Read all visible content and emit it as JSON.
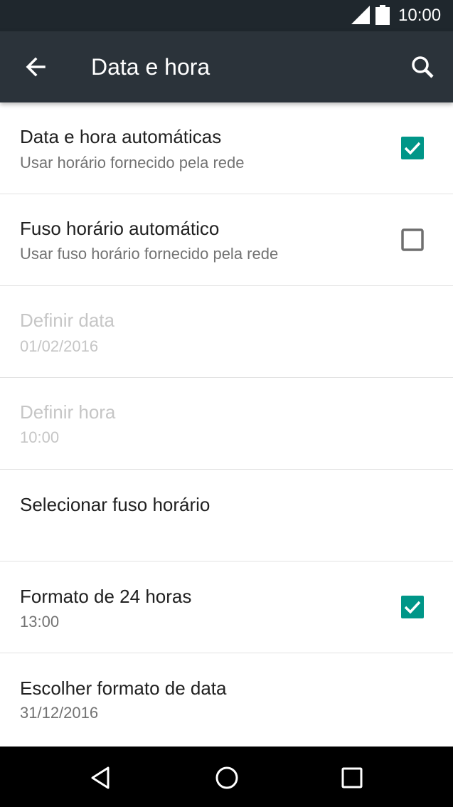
{
  "status_bar": {
    "time": "10:00"
  },
  "toolbar": {
    "title": "Data e hora"
  },
  "settings": [
    {
      "title": "Data e hora automáticas",
      "summary": "Usar horário fornecido pela rede",
      "checked": true,
      "enabled": true
    },
    {
      "title": "Fuso horário automático",
      "summary": "Usar fuso horário fornecido pela rede",
      "checked": false,
      "enabled": true
    },
    {
      "title": "Definir data",
      "summary": "01/02/2016",
      "enabled": false
    },
    {
      "title": "Definir hora",
      "summary": "10:00",
      "enabled": false
    },
    {
      "title": "Selecionar fuso horário",
      "summary": "",
      "enabled": true
    },
    {
      "title": "Formato de 24 horas",
      "summary": "13:00",
      "checked": true,
      "enabled": true
    },
    {
      "title": "Escolher formato de data",
      "summary": "31/12/2016",
      "enabled": true
    }
  ],
  "colors": {
    "accent": "#009688",
    "toolbar": "#2b333a",
    "status_bar": "#1f272d"
  },
  "icons": [
    "signal-icon",
    "battery-icon",
    "back-arrow-icon",
    "search-icon",
    "checkbox-checked-icon",
    "checkbox-unchecked-icon",
    "nav-back-icon",
    "nav-home-icon",
    "nav-recents-icon"
  ]
}
